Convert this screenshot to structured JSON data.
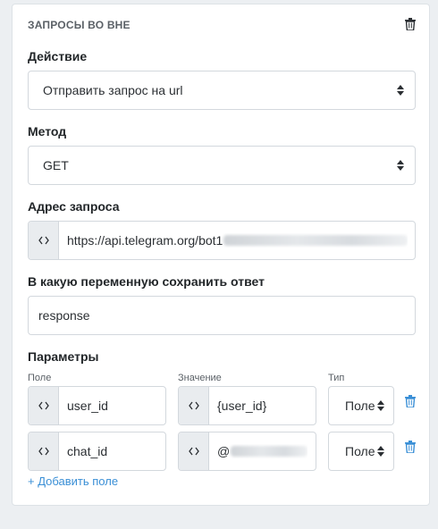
{
  "section": {
    "title": "ЗАПРОСЫ ВО ВНЕ"
  },
  "action": {
    "label": "Действие",
    "value": "Отправить запрос на url"
  },
  "method": {
    "label": "Метод",
    "value": "GET"
  },
  "url": {
    "label": "Адрес запроса",
    "value": "https://api.telegram.org/bot1"
  },
  "response_var": {
    "label": "В какую переменную сохранить ответ",
    "value": "response"
  },
  "params": {
    "label": "Параметры",
    "col_field": "Поле",
    "col_value": "Значение",
    "col_type": "Тип",
    "rows": [
      {
        "field": "user_id",
        "value": "{user_id}",
        "type": "Поле"
      },
      {
        "field": "chat_id",
        "value": "@",
        "type": "Поле"
      }
    ],
    "add_label": "+ Добавить поле"
  },
  "colors": {
    "accent": "#3a8fd6",
    "addon_bg": "#e9ecef",
    "border": "#d3d8dd",
    "page_bg": "#eceff2"
  },
  "icons": {
    "delete": "trash-icon",
    "code": "code-brackets-icon",
    "select": "sort-caret-icon"
  }
}
